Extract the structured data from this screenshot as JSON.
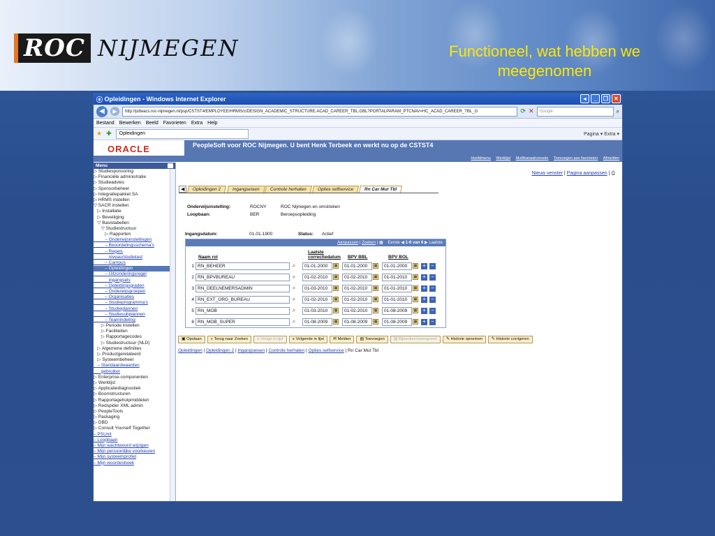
{
  "slide": {
    "logo_roc": "ROC",
    "logo_rest": "NIJMEGEN",
    "title_line1": "Functioneel, wat hebben we",
    "title_line2": "meegenomen"
  },
  "window": {
    "title": "Opleidingen - Windows Internet Explorer",
    "url": "http://pdwacs.roc-nijmegen.nl/psp/CSTST4/EMPLOYEE/HRMS/c/DESIGN_ACADEMIC_STRUCTURE.ACAD_CAREER_TBL.GBL?PORTALPARAM_PTCNAV=HC_ACAD_CAREER_TBL_G",
    "search_placeholder": "Google",
    "menu": [
      "Bestand",
      "Bewerken",
      "Beeld",
      "Favorieten",
      "Extra",
      "Help"
    ],
    "tab_label": "Opleidingen",
    "tools_label": "Pagina ▾  Extra ▾"
  },
  "ps": {
    "oracle": "ORACLE",
    "banner": "PeopleSoft voor ROC Nijmegen. U bent Henk Terbeek en werkt nu op de CSTST4",
    "links": [
      "Hoofdmenu",
      "Werklijst",
      "Multikanaalconsole",
      "Toevoegen aan favorieten",
      "Afmelden"
    ]
  },
  "sidebar": {
    "title": "Menu",
    "items": [
      {
        "t": "▷ Studiesponsoring",
        "c": ""
      },
      {
        "t": "▷ Financiële administratie",
        "c": ""
      },
      {
        "t": "▷ Studieadvies",
        "c": ""
      },
      {
        "t": "▷ Sponsorbeheer",
        "c": ""
      },
      {
        "t": "▷ Integratiepakket SA",
        "c": ""
      },
      {
        "t": "▷ HRMS instellen",
        "c": ""
      },
      {
        "t": "▽ SACR instellen",
        "c": ""
      },
      {
        "t": "   ▷ Installatie",
        "c": ""
      },
      {
        "t": "   ▷ Beveiliging",
        "c": ""
      },
      {
        "t": "   ▽ Basistabellen",
        "c": ""
      },
      {
        "t": "      ▽ Studiestructuur",
        "c": ""
      },
      {
        "t": "         ▷ Rapporten",
        "c": ""
      },
      {
        "t": "         – Onderwijsinstellingen",
        "c": "link"
      },
      {
        "t": "         – Beoordelingsschema's",
        "c": "link"
      },
      {
        "t": "         – Regels",
        "c": "link"
      },
      {
        "t": "            niveau/studielast",
        "c": "link"
      },
      {
        "t": "         – Campus",
        "c": "link"
      },
      {
        "t": "         – Opleidingen",
        "c": "sel"
      },
      {
        "t": "         – Uitzonderingsregel",
        "c": "link"
      },
      {
        "t": "            ingangsels",
        "c": "link"
      },
      {
        "t": "         – Opleidingsgraden",
        "c": "link"
      },
      {
        "t": "         – Onderwijsgroepen",
        "c": "link"
      },
      {
        "t": "         – Organisaties",
        "c": "link"
      },
      {
        "t": "         – Studieprogramma's",
        "c": "link"
      },
      {
        "t": "         – Studieplannen",
        "c": "link"
      },
      {
        "t": "         – Studiesubplannen",
        "c": "link"
      },
      {
        "t": "         – Teamindeling",
        "c": "link"
      },
      {
        "t": "      ▷ Periode instellen",
        "c": ""
      },
      {
        "t": "      ▷ Faciliteiten",
        "c": ""
      },
      {
        "t": "      ▷ Rapportagecodes",
        "c": ""
      },
      {
        "t": "      ▷ Studiestructuur (NLD)",
        "c": ""
      },
      {
        "t": "   ▷ Algemene definities",
        "c": ""
      },
      {
        "t": "   ▷ Productgerelateerd",
        "c": ""
      },
      {
        "t": "   ▷ Systeembeheer",
        "c": ""
      },
      {
        "t": "   – Standaardwaarden",
        "c": "link"
      },
      {
        "t": "      gebruiker",
        "c": "link"
      },
      {
        "t": "▷ Enterprise-componenten",
        "c": ""
      },
      {
        "t": "▷ Werklijst",
        "c": ""
      },
      {
        "t": "▷ Applicatiediagnostiek",
        "c": ""
      },
      {
        "t": "▷ Boomstructuren",
        "c": ""
      },
      {
        "t": "▷ Rapportagehulpmiddelen",
        "c": ""
      },
      {
        "t": "▷ Redspider XML admin",
        "c": ""
      },
      {
        "t": "▷ PeopleTools",
        "c": ""
      },
      {
        "t": "▷ Packaging",
        "c": ""
      },
      {
        "t": "▷ DBD",
        "c": ""
      },
      {
        "t": "▷ Consult Yourself Together",
        "c": ""
      },
      {
        "t": "– PSUnit",
        "c": "link"
      },
      {
        "t": "– Loopbaan",
        "c": "link"
      },
      {
        "t": "– Mijn wachtwoord wijzigen",
        "c": "link"
      },
      {
        "t": "– Mijn persoonlijke voorkeuren",
        "c": "link"
      },
      {
        "t": "– Mijn systeemprofiel",
        "c": "link"
      },
      {
        "t": "– Mijn woordenboek",
        "c": "link"
      }
    ]
  },
  "content": {
    "new_window": "Nieuw venster",
    "customize": "Pagina aanpassen",
    "tabs": [
      "Opleidingen 2",
      "Ingangseisen",
      "Controle herhalen",
      "Opties selfservice",
      "Rn Car Mut Tbl"
    ],
    "info": [
      {
        "k": "Onderwijsinstelling:",
        "v1": "ROCNY",
        "v2": "ROC Nijmegen en omstreken"
      },
      {
        "k": "Loopbaan:",
        "v1": "BER",
        "v2": "Beroepsopleiding"
      }
    ],
    "ingang_label": "Ingangsdatum:",
    "ingang_value": "01-01-1900",
    "status_label": "Status:",
    "status_value": "Actief",
    "grid_nav": {
      "customize": "Aanpassen",
      "find": "Zoeken",
      "first": "Eerste",
      "range": "1-6 van 6",
      "last": "Laatste"
    },
    "columns": [
      "Naam rol",
      "Laatste correctiedatum",
      "BPV BBL",
      "BPV BOL"
    ],
    "rows": [
      {
        "n": "1",
        "name": "RN_BEHEER",
        "d1": "01-01-2000",
        "d2": "01-01-2000",
        "d3": "01-01-2000"
      },
      {
        "n": "2",
        "name": "RN_BPVBUREAU",
        "d1": "01-02-2010",
        "d2": "01-02-2010",
        "d3": "01-01-2010"
      },
      {
        "n": "3",
        "name": "RN_DEELNEMERSADMIN",
        "d1": "01-03-2010",
        "d2": "01-02-2010",
        "d3": "01-01-2010"
      },
      {
        "n": "4",
        "name": "RN_EXT_ORG_BUREAU",
        "d1": "01-02-2010",
        "d2": "01-02-2010",
        "d3": "01-01-2010"
      },
      {
        "n": "5",
        "name": "RN_MOB",
        "d1": "01-03-2010",
        "d2": "01-02-2010",
        "d3": "01-08-2009"
      },
      {
        "n": "6",
        "name": "RN_MOB_SUPER",
        "d1": "01-08-2009",
        "d2": "01-08-2009",
        "d3": "01-08-2009"
      }
    ],
    "buttons": [
      {
        "label": "Opslaan",
        "dis": false
      },
      {
        "label": "Terug naar Zoeken",
        "dis": false
      },
      {
        "label": "Vorige in lijst",
        "dis": true
      },
      {
        "label": "Volgende in lijst",
        "dis": false
      },
      {
        "label": "Melden",
        "dis": false
      },
      {
        "label": "Toevoegen",
        "dis": false
      },
      {
        "label": "Bijwerken/weergeven",
        "dis": true
      },
      {
        "label": "Historie opnemen",
        "dis": false
      },
      {
        "label": "Historie corrigeren",
        "dis": false
      }
    ],
    "bottom_links": [
      "Opleidingen",
      "Opleidingen 2",
      "Ingangseisen",
      "Controle herhalen",
      "Opties selfservice"
    ],
    "bottom_current": "Rn Car Mut Tbl"
  }
}
